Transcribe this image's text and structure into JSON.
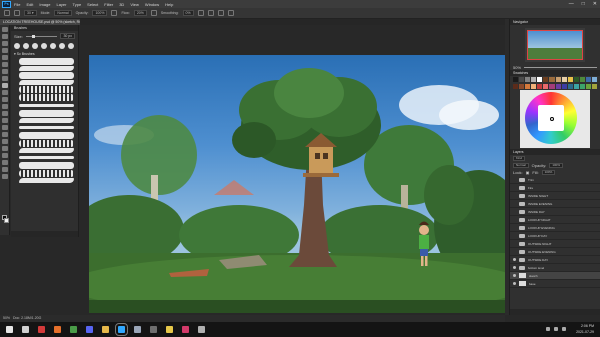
{
  "app": {
    "logo": "Ps"
  },
  "menu": [
    "File",
    "Edit",
    "Image",
    "Layer",
    "Type",
    "Select",
    "Filter",
    "3D",
    "View",
    "Window",
    "Help"
  ],
  "window_controls": {
    "minimize": "—",
    "maximize": "□",
    "close": "✕"
  },
  "options_bar": {
    "mode_label": "Mode:",
    "mode_value": "Normal",
    "opacity_label": "Opacity:",
    "opacity_value": "100%",
    "flow_label": "Flow:",
    "flow_value": "20%",
    "smoothing_label": "Smoothing:",
    "smoothing_value": "0%"
  },
  "document": {
    "tab_title": "LOCATION TREEHOUSE.psd @ 50% (sketch, RGB/8)"
  },
  "brush_panel": {
    "title": "Brushes",
    "size_label": "Size:",
    "size_value": "30 px",
    "folder": "Sc Brushes"
  },
  "navigator": {
    "title": "Navigator",
    "zoom": "50%"
  },
  "swatches": {
    "title": "Swatches",
    "colors": [
      "#1a1a1a",
      "#4a4a4a",
      "#808080",
      "#b3b3b3",
      "#ffffff",
      "#6b3d1e",
      "#9a6b3c",
      "#c9a070",
      "#e7cfa8",
      "#e8c24a",
      "#2d5a27",
      "#4d8a3c",
      "#3d6aa8",
      "#7eaed6",
      "#5c2b1a",
      "#8c4a2a",
      "#d67a3c",
      "#f2b27a",
      "#c23b3b",
      "#e86a6a",
      "#a33c7a",
      "#6a3ca3",
      "#3c3ca3",
      "#2b6a8c",
      "#3ca3a3",
      "#3ca36a",
      "#6aa33c",
      "#a3a33c"
    ]
  },
  "layers": {
    "title": "Layers",
    "kind_label": "Kind",
    "blend_mode": "Normal",
    "opacity_label": "Opacity:",
    "opacity_value": "100%",
    "lock_label": "Lock:",
    "fill_label": "Fill:",
    "fill_value": "100%",
    "items": [
      {
        "name": "Trim",
        "type": "folder",
        "visible": false,
        "selected": false
      },
      {
        "name": "Fire",
        "type": "folder",
        "visible": false,
        "selected": false
      },
      {
        "name": "INSIDE NIGHT",
        "type": "folder",
        "visible": false,
        "selected": false
      },
      {
        "name": "INSIDE EVENING",
        "type": "folder",
        "visible": false,
        "selected": false
      },
      {
        "name": "INSIDE DAY",
        "type": "folder",
        "visible": false,
        "selected": false
      },
      {
        "name": "LOOKUP NIGHT",
        "type": "folder",
        "visible": false,
        "selected": false
      },
      {
        "name": "LOOKUP EVENING",
        "type": "folder",
        "visible": false,
        "selected": false
      },
      {
        "name": "LOOKUP DAY",
        "type": "folder",
        "visible": false,
        "selected": false
      },
      {
        "name": "OUTSIDE NIGHT",
        "type": "folder",
        "visible": false,
        "selected": false
      },
      {
        "name": "OUTSIDE EVENING",
        "type": "folder",
        "visible": false,
        "selected": false
      },
      {
        "name": "OUTSIDE DAY",
        "type": "folder",
        "visible": true,
        "selected": false
      },
      {
        "name": "bottom level",
        "type": "folder",
        "visible": true,
        "selected": false
      },
      {
        "name": "sketch",
        "type": "layer",
        "visible": true,
        "selected": true
      },
      {
        "name": "base",
        "type": "layer",
        "visible": true,
        "selected": false
      }
    ]
  },
  "status": {
    "zoom": "50%",
    "doc": "Doc: 2.18M/1.20G"
  },
  "taskbar": {
    "icons": [
      {
        "name": "start-icon",
        "color": "#e6e6e6"
      },
      {
        "name": "search-icon",
        "color": "#d0d0d0"
      },
      {
        "name": "media-icon",
        "color": "#d33a3a"
      },
      {
        "name": "firefox-icon",
        "color": "#e6702b"
      },
      {
        "name": "chrome-icon",
        "color": "#4a9c48"
      },
      {
        "name": "discord-icon",
        "color": "#5865f2"
      },
      {
        "name": "explorer-icon",
        "color": "#e6b84a"
      },
      {
        "name": "photoshop-icon",
        "color": "#31a8ff"
      },
      {
        "name": "steam-icon",
        "color": "#9aa6b8"
      },
      {
        "name": "obs-icon",
        "color": "#6e6e6e"
      },
      {
        "name": "notes-icon",
        "color": "#e6c84a"
      },
      {
        "name": "music-icon",
        "color": "#d33a6a"
      },
      {
        "name": "terminal-icon",
        "color": "#b0b0b0"
      }
    ],
    "active_icon": "photoshop-icon",
    "time": "2:06 PM",
    "date": "2021-07-29"
  }
}
